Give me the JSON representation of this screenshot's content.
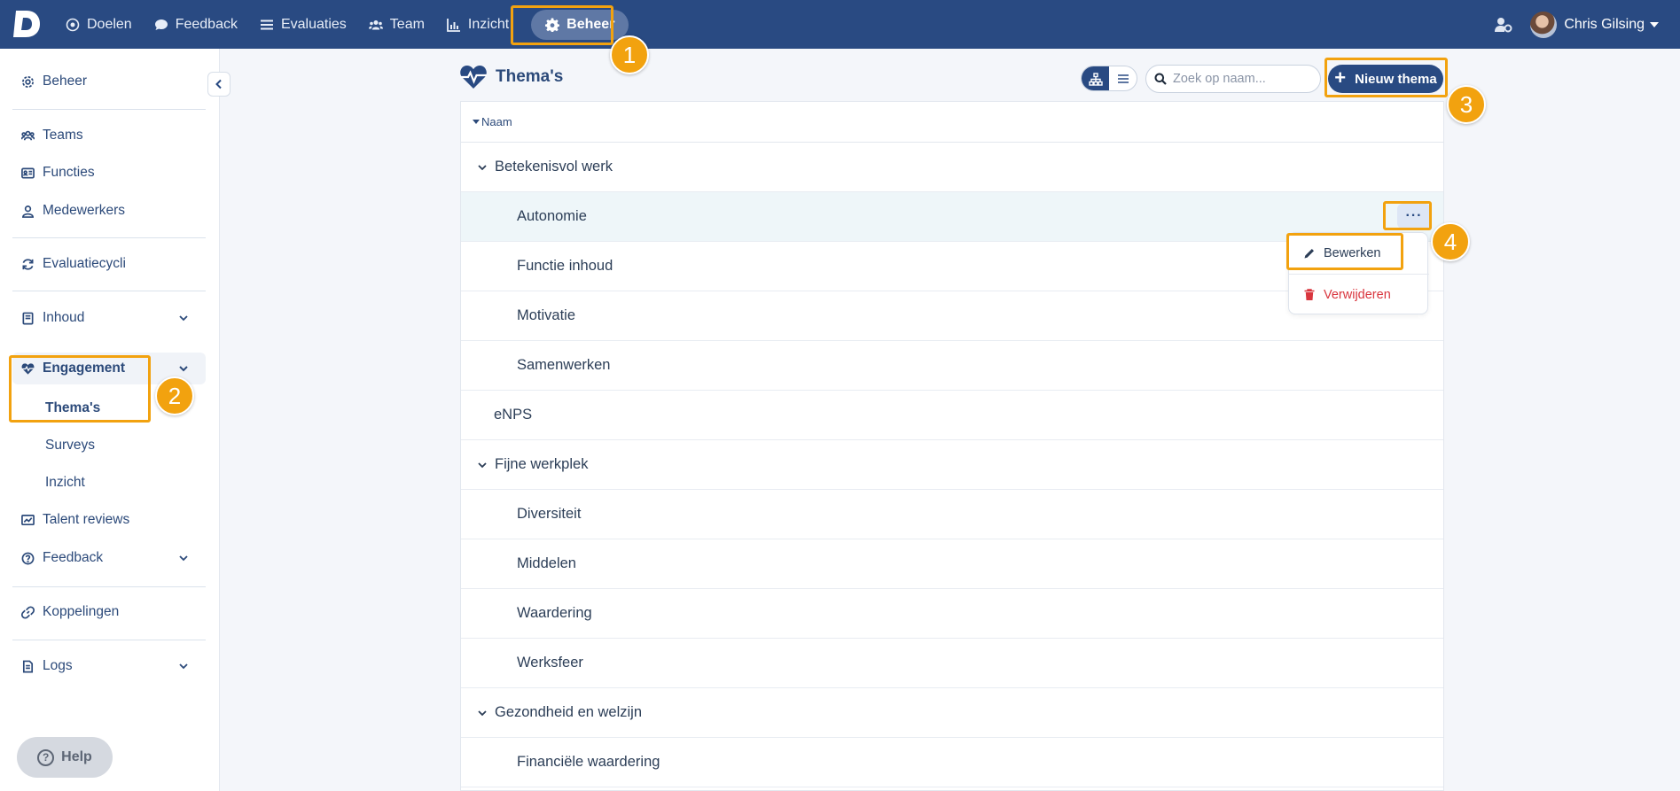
{
  "topnav": {
    "items": [
      {
        "label": "Doelen",
        "icon": "target-icon"
      },
      {
        "label": "Feedback",
        "icon": "chat-icon"
      },
      {
        "label": "Evaluaties",
        "icon": "list-icon"
      },
      {
        "label": "Team",
        "icon": "users-icon"
      },
      {
        "label": "Inzicht",
        "icon": "chart-icon"
      },
      {
        "label": "Beheer",
        "icon": "gear-icon",
        "active": true
      }
    ],
    "user_name": "Chris Gilsing"
  },
  "sidebar": {
    "beheer": "Beheer",
    "teams": "Teams",
    "functies": "Functies",
    "medewerkers": "Medewerkers",
    "evaluatiecycli": "Evaluatiecycli",
    "inhoud": "Inhoud",
    "engagement": "Engagement",
    "themas": "Thema's",
    "surveys": "Surveys",
    "inzicht": "Inzicht",
    "talent_reviews": "Talent reviews",
    "feedback": "Feedback",
    "koppelingen": "Koppelingen",
    "logs": "Logs",
    "help": "Help"
  },
  "main": {
    "title": "Thema's",
    "search_placeholder": "Zoek op naam...",
    "new_button": "Nieuw thema",
    "column_header": "Naam",
    "rows": [
      {
        "label": "Betekenisvol werk",
        "type": "group"
      },
      {
        "label": "Autonomie",
        "type": "child",
        "hover": true
      },
      {
        "label": "Functie inhoud",
        "type": "child"
      },
      {
        "label": "Motivatie",
        "type": "child"
      },
      {
        "label": "Samenwerken",
        "type": "child"
      },
      {
        "label": "eNPS",
        "type": "leaf"
      },
      {
        "label": "Fijne werkplek",
        "type": "group"
      },
      {
        "label": "Diversiteit",
        "type": "child"
      },
      {
        "label": "Middelen",
        "type": "child"
      },
      {
        "label": "Waardering",
        "type": "child"
      },
      {
        "label": "Werksfeer",
        "type": "child"
      },
      {
        "label": "Gezondheid en welzijn",
        "type": "group"
      },
      {
        "label": "Financiële waardering",
        "type": "child"
      }
    ],
    "more_button": "···",
    "dropdown": {
      "edit": "Bewerken",
      "delete": "Verwijderen"
    }
  },
  "annotations": [
    "1",
    "2",
    "3",
    "4"
  ],
  "colors": {
    "navbar": "#294a82",
    "accent": "#294a82",
    "highlight": "#f2a20f",
    "danger": "#d9363e",
    "row_hover": "#eef6f9"
  }
}
